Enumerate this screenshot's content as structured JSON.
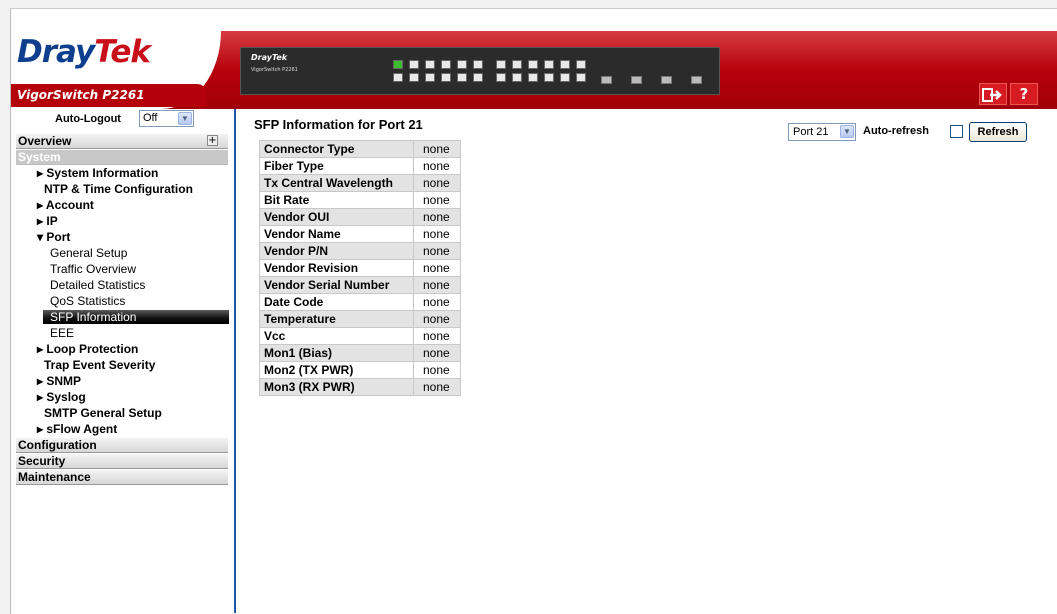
{
  "header": {
    "logo_dray": "Dray",
    "logo_tek": "Tek",
    "model": "VigorSwitch P2261",
    "device_brand": "DrayTek",
    "device_model": "VigorSwitch P2261",
    "logout_icon": "logout-icon",
    "help_label": "?"
  },
  "sidebar": {
    "auto_logout_label": "Auto-Logout",
    "auto_logout_value": "Off",
    "categories": {
      "overview": "Overview",
      "system": "System",
      "configuration": "Configuration",
      "security": "Security",
      "maintenance": "Maintenance"
    },
    "items": {
      "system_information": "▸ System Information",
      "ntp": "NTP & Time Configuration",
      "account": "▸ Account",
      "ip": "▸ IP",
      "port": "▾ Port",
      "general_setup": "General Setup",
      "traffic_overview": "Traffic Overview",
      "detailed_statistics": "Detailed Statistics",
      "qos_statistics": "QoS Statistics",
      "sfp_information": "SFP Information",
      "eee": "EEE",
      "loop_protection": "▸ Loop Protection",
      "trap_event_severity": "Trap Event Severity",
      "snmp": "▸ SNMP",
      "syslog": "▸ Syslog",
      "smtp": "SMTP General Setup",
      "sflow": "▸ sFlow Agent"
    }
  },
  "main": {
    "title": "SFP Information for  Port 21",
    "port_select_value": "Port 21",
    "auto_refresh_label": "Auto-refresh",
    "auto_refresh_checked": false,
    "refresh_label": "Refresh",
    "rows": [
      {
        "key": "Connector Type",
        "value": "none"
      },
      {
        "key": "Fiber Type",
        "value": "none"
      },
      {
        "key": "Tx Central Wavelength",
        "value": "none"
      },
      {
        "key": "Bit Rate",
        "value": "none"
      },
      {
        "key": "Vendor OUI",
        "value": "none"
      },
      {
        "key": "Vendor Name",
        "value": "none"
      },
      {
        "key": "Vendor P/N",
        "value": "none"
      },
      {
        "key": "Vendor Revision",
        "value": "none"
      },
      {
        "key": "Vendor Serial Number",
        "value": "none"
      },
      {
        "key": "Date Code",
        "value": "none"
      },
      {
        "key": "Temperature",
        "value": "none"
      },
      {
        "key": "Vcc",
        "value": "none"
      },
      {
        "key": "Mon1 (Bias)",
        "value": "none"
      },
      {
        "key": "Mon2 (TX PWR)",
        "value": "none"
      },
      {
        "key": "Mon3 (RX PWR)",
        "value": "none"
      }
    ]
  }
}
